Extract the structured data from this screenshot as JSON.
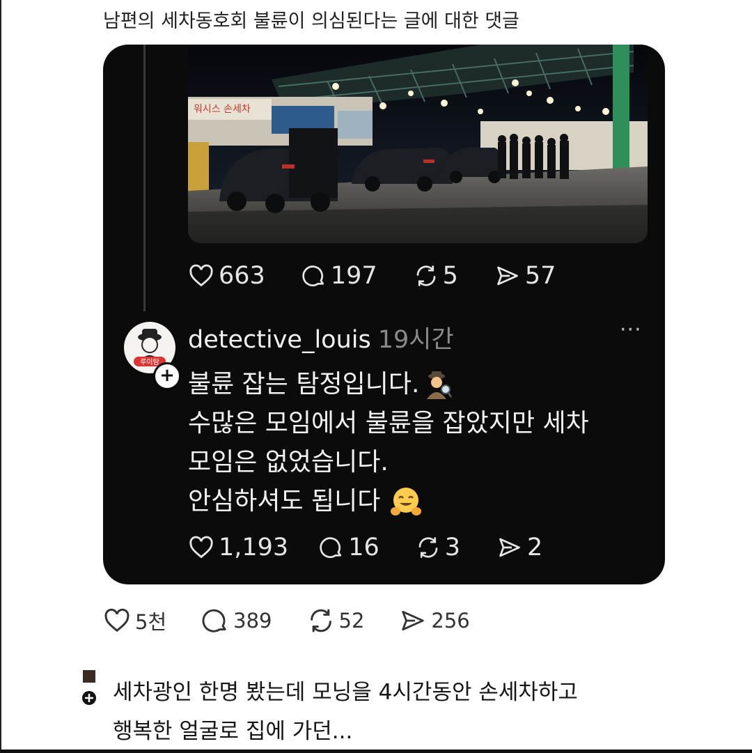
{
  "header": {
    "title": "남편의 세차동호회 불륜이 의심된다는 글에 대한 댓글"
  },
  "post": {
    "stats": {
      "likes": "663",
      "comments": "197",
      "reposts": "5",
      "shares": "57"
    }
  },
  "reply": {
    "username": "detective_louis",
    "time": "19시간",
    "more_label": "···",
    "avatar_text": "루이탐",
    "follow_label": "+",
    "lines": [
      "불륜 잡는 탐정입니다.",
      "수많은 모임에서 불륜을 잡았지만 세차",
      "모임은 없었습니다.",
      "안심하셔도 됩니다"
    ],
    "stats": {
      "likes": "1,193",
      "comments": "16",
      "reposts": "3",
      "shares": "2"
    }
  },
  "outer_stats": {
    "likes": "5천",
    "comments": "389",
    "reposts": "52",
    "shares": "256"
  },
  "comment": {
    "lines": [
      "세차광인 한명 봤는데 모닝을 4시간동안 손세차하고",
      "행복한 얼굴로 집에 가던..."
    ]
  },
  "photo": {
    "sign_text": "워시스 손세차"
  },
  "icons": [
    "heart-icon",
    "comment-icon",
    "repost-icon",
    "share-icon",
    "detective-emoji-icon",
    "hugging-emoji-icon",
    "more-icon"
  ],
  "colors": {
    "card_bg": "#0b0b0b",
    "muted": "#8a8a8a",
    "text_light": "#f2f2f2"
  }
}
